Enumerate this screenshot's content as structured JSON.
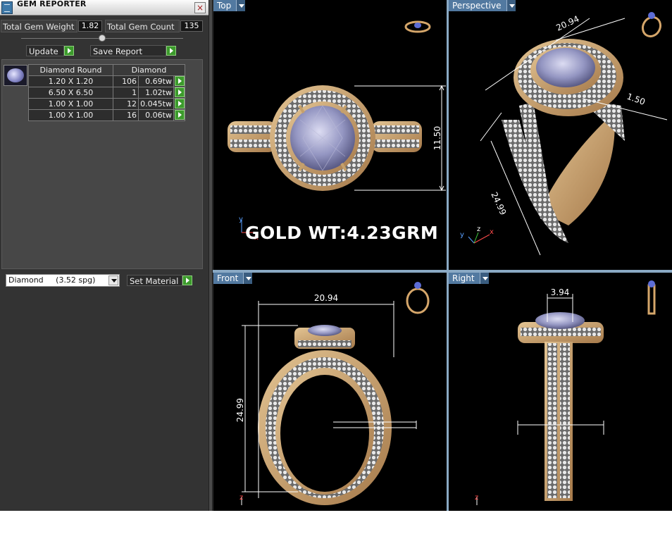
{
  "panel": {
    "title": "GEM REPORTER",
    "close_label": "×",
    "total_gem_weight_label": "Total Gem Weight",
    "total_gem_weight_value": "1.82",
    "total_gem_count_label": "Total Gem Count",
    "total_gem_count_value": "135",
    "update_label": "Update",
    "save_report_label": "Save Report",
    "table": {
      "headers": [
        "Diamond Round",
        "Diamond"
      ],
      "rows": [
        {
          "size": "1.20 X 1.20",
          "count": "106",
          "weight": "0.69tw"
        },
        {
          "size": "6.50 X 6.50",
          "count": "1",
          "weight": "1.02tw"
        },
        {
          "size": "1.00 X 1.00",
          "count": "12",
          "weight": "0.045tw"
        },
        {
          "size": "1.00 X 1.00",
          "count": "16",
          "weight": "0.06tw"
        }
      ]
    },
    "material_value": "Diamond     (3.52 spg)",
    "set_material_label": "Set Material"
  },
  "viewports": {
    "top": {
      "label": "Top",
      "dimension": "11.50",
      "annotation": "GOLD WT:4.23GRM",
      "axis_x": "x",
      "axis_y": "y"
    },
    "perspective": {
      "label": "Perspective",
      "dim_top": "20.94",
      "dim_right": "1.50",
      "dim_left": "24.99",
      "axis_x": "x",
      "axis_y": "y",
      "axis_z": "z"
    },
    "front": {
      "label": "Front",
      "dim_width": "20.94",
      "dim_height": "24.99",
      "axis_z": "z"
    },
    "right": {
      "label": "Right",
      "dim_width": "3.94",
      "axis_z": "z"
    }
  },
  "colors": {
    "viewport_label_bg": "#5279a0",
    "viewport_border": "#8aa9c4",
    "gold": "#c8a06a",
    "go_button": "#3c9b2c"
  }
}
